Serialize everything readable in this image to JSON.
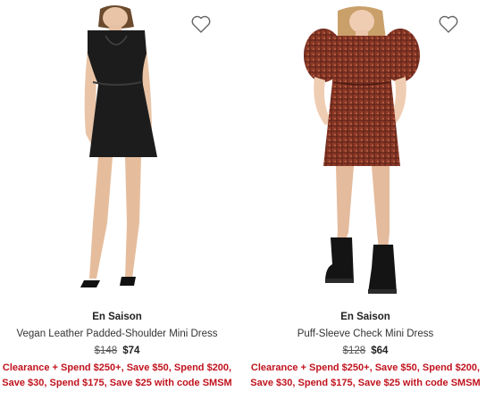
{
  "products": [
    {
      "brand": "En Saison",
      "name": "Vegan Leather Padded-Shoulder Mini Dress",
      "original_price": "$148",
      "sale_price": "$74",
      "promo": "Clearance + Spend $250+, Save $50, Spend $200, Save $30, Spend $175, Save $25 with code SMSM",
      "wishlist_icon": "heart-outline-icon"
    },
    {
      "brand": "En Saison",
      "name": "Puff-Sleeve Check Mini Dress",
      "original_price": "$128",
      "sale_price": "$64",
      "promo": "Clearance + Spend $250+, Save $50, Spend $200, Save $30, Spend $175, Save $25 with code SMSM",
      "wishlist_icon": "heart-outline-icon"
    }
  ],
  "colors": {
    "promo_red": "#c0121d",
    "text": "#222222"
  }
}
